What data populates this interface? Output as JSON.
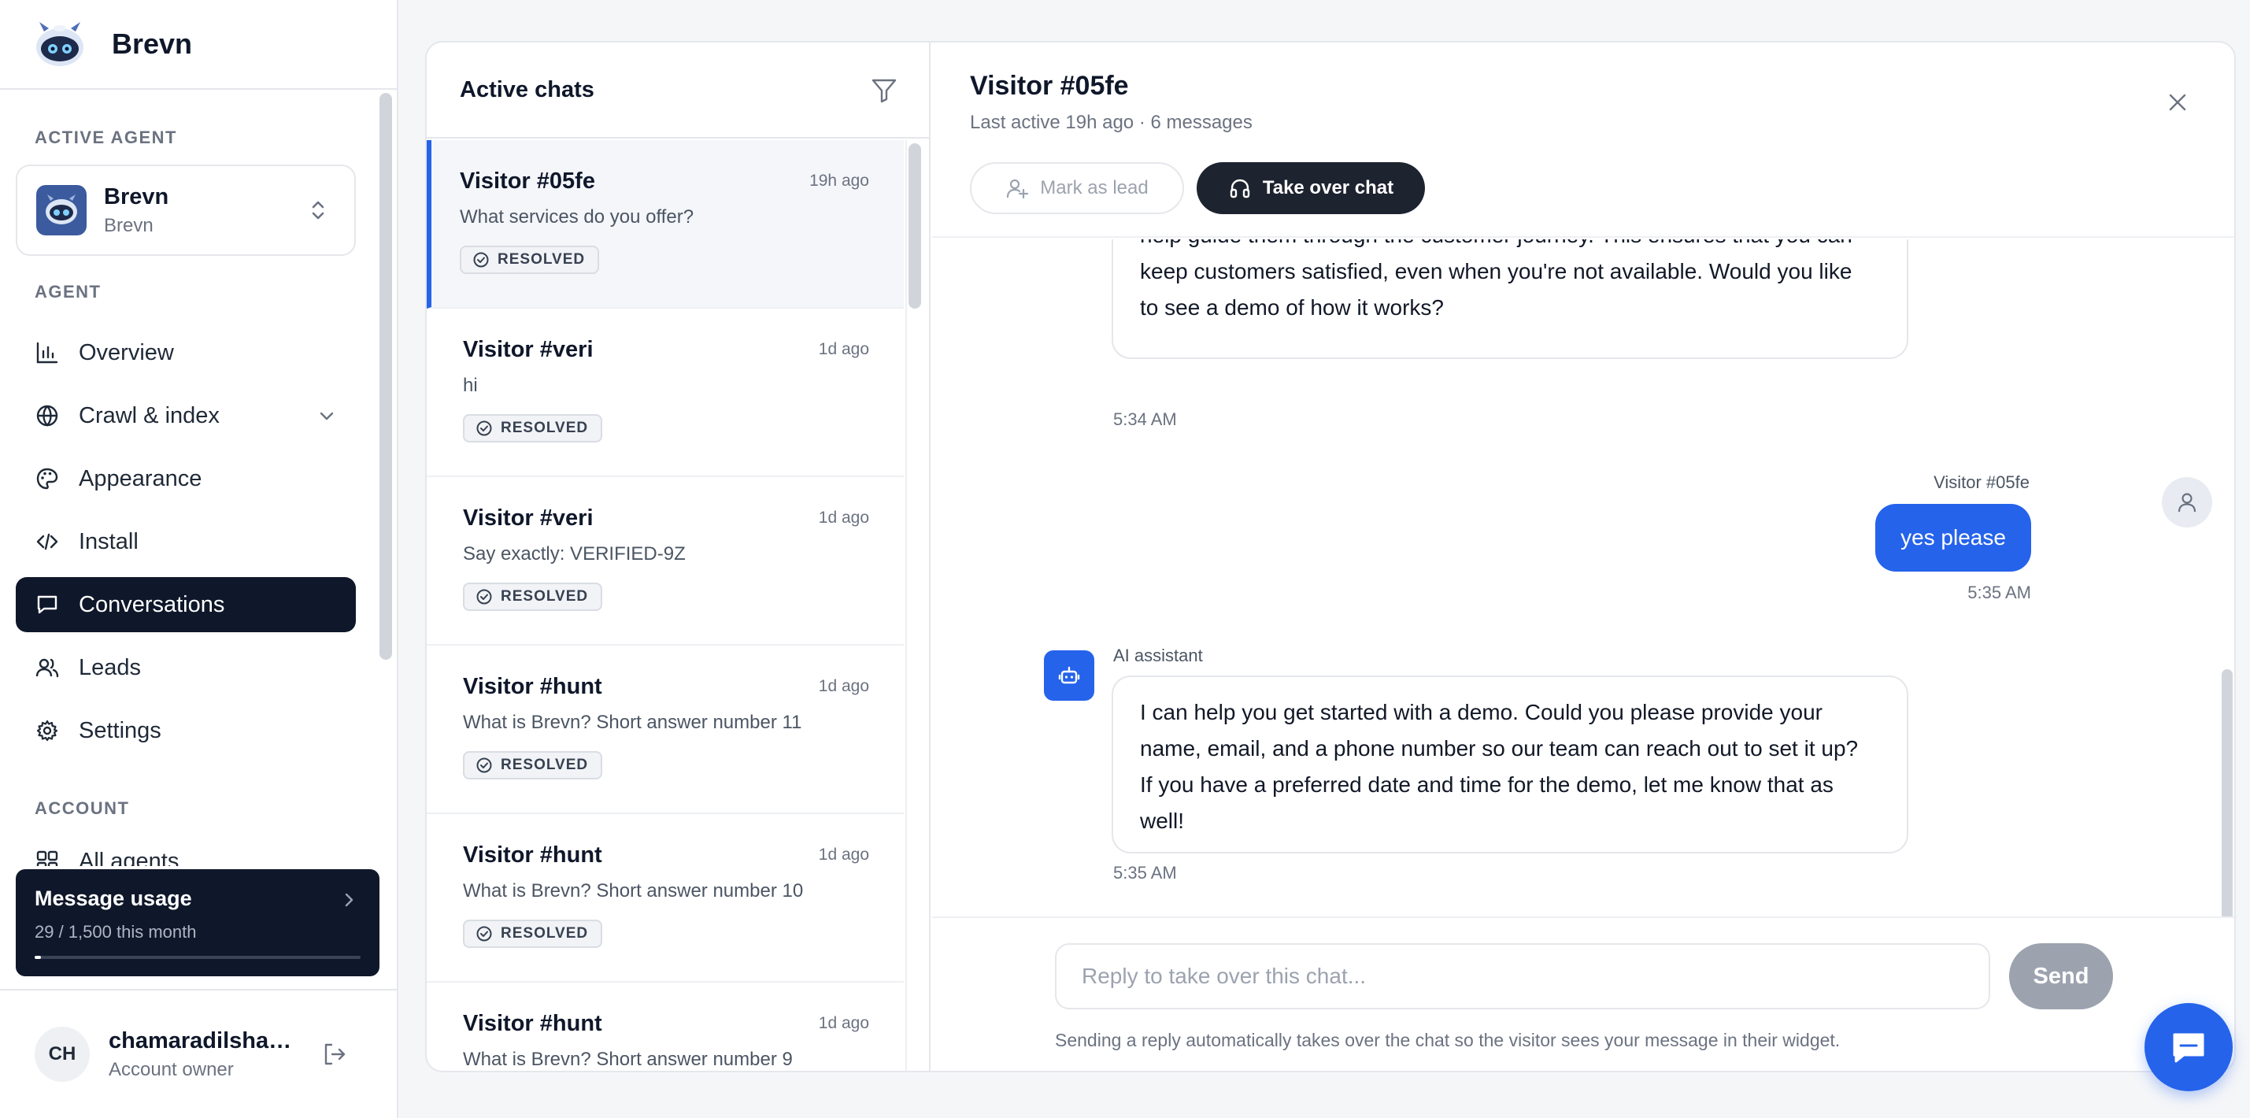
{
  "brand": {
    "name": "Brevn"
  },
  "sidebar": {
    "active_agent_label": "ACTIVE AGENT",
    "agent": {
      "name": "Brevn",
      "subtitle": "Brevn"
    },
    "agent_section_label": "AGENT",
    "nav": [
      {
        "label": "Overview",
        "icon": "bar-chart-icon"
      },
      {
        "label": "Crawl & index",
        "icon": "globe-icon"
      },
      {
        "label": "Appearance",
        "icon": "palette-icon"
      },
      {
        "label": "Install",
        "icon": "code-icon"
      },
      {
        "label": "Conversations",
        "icon": "message-square-icon",
        "active": true
      },
      {
        "label": "Leads",
        "icon": "users-icon"
      },
      {
        "label": "Settings",
        "icon": "gear-icon"
      }
    ],
    "account_section_label": "ACCOUNT",
    "account_partial_item": "All agents",
    "usage": {
      "title": "Message usage",
      "subtitle": "29 / 1,500 this month",
      "used": 29,
      "limit": 1500
    },
    "account": {
      "initials": "CH",
      "name": "chamaradilshan...",
      "role": "Account owner"
    }
  },
  "chat_list": {
    "title": "Active chats",
    "items": [
      {
        "name": "Visitor #05fe",
        "time": "19h ago",
        "preview": "What services do you offer?",
        "status": "RESOLVED",
        "selected": true
      },
      {
        "name": "Visitor #veri",
        "time": "1d ago",
        "preview": "hi",
        "status": "RESOLVED"
      },
      {
        "name": "Visitor #veri",
        "time": "1d ago",
        "preview": "Say exactly: VERIFIED-9Z",
        "status": "RESOLVED"
      },
      {
        "name": "Visitor #hunt",
        "time": "1d ago",
        "preview": "What is Brevn? Short answer number 11",
        "status": "RESOLVED"
      },
      {
        "name": "Visitor #hunt",
        "time": "1d ago",
        "preview": "What is Brevn? Short answer number 10",
        "status": "RESOLVED"
      },
      {
        "name": "Visitor #hunt",
        "time": "1d ago",
        "preview": "What is Brevn? Short answer number 9",
        "status": "RESOLVED"
      }
    ]
  },
  "conversation": {
    "title": "Visitor #05fe",
    "subtitle": "Last active 19h ago · 6 messages",
    "mark_lead_label": "Mark as lead",
    "take_over_label": "Take over chat",
    "messages": [
      {
        "role": "ai",
        "lines": [
          "help guide them through the customer journey. This ensures that you can",
          "keep customers satisfied, even when you're not available. Would you like",
          "to see a demo of how it works?"
        ],
        "time": "5:34 AM"
      },
      {
        "role": "user",
        "sender": "Visitor #05fe",
        "text": "yes please",
        "time": "5:35 AM"
      },
      {
        "role": "ai",
        "sender": "AI assistant",
        "lines": [
          "I can help you get started with a demo. Could you please provide your",
          "name, email, and a phone number so our team can reach out to set it up?",
          "If you have a preferred date and time for the demo, let me know that as",
          "well!"
        ],
        "time": "5:35 AM"
      }
    ],
    "reply_placeholder": "Reply to take over this chat...",
    "send_label": "Send",
    "hint": "Sending a reply automatically takes over the chat so the visitor sees your message in their widget."
  },
  "colors": {
    "accent": "#2563eb",
    "dark": "#0f172a",
    "muted": "#6b7280"
  }
}
